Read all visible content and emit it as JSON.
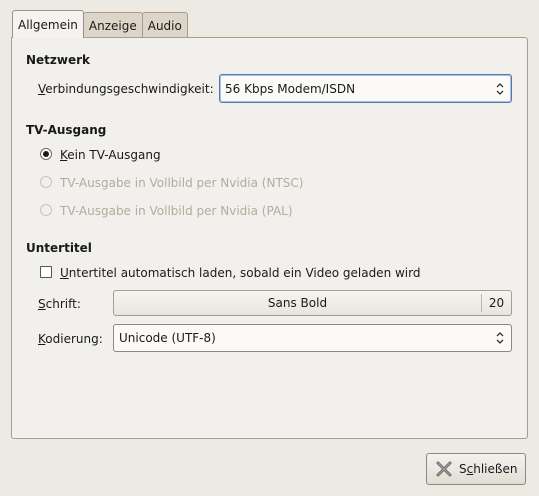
{
  "tabs": [
    {
      "label": "Allgemein",
      "active": true
    },
    {
      "label": "Anzeige",
      "active": false
    },
    {
      "label": "Audio",
      "active": false
    }
  ],
  "network": {
    "title": "Netzwerk",
    "speed_label_mnemonic": "V",
    "speed_label_rest": "erbindungsgeschwindigkeit:",
    "speed_value": "56 Kbps Modem/ISDN"
  },
  "tv": {
    "title": "TV-Ausgang",
    "options": [
      {
        "mnemonic": "K",
        "rest": "ein TV-Ausgang",
        "checked": true,
        "disabled": false
      },
      {
        "mnemonic": "",
        "rest": "TV-Ausgabe in Vollbild per Nvidia (NTSC)",
        "checked": false,
        "disabled": true
      },
      {
        "mnemonic": "",
        "rest": "TV-Ausgabe in Vollbild per Nvidia (PAL)",
        "checked": false,
        "disabled": true
      }
    ]
  },
  "subtitles": {
    "title": "Untertitel",
    "autoload_mnemonic": "U",
    "autoload_rest": "ntertitel automatisch laden, sobald ein Video geladen wird",
    "autoload_checked": false,
    "font_label_mnemonic": "S",
    "font_label_rest": "chrift:",
    "font_name": "Sans Bold",
    "font_size": "20",
    "encoding_label_mnemonic": "K",
    "encoding_label_rest": "odierung:",
    "encoding_value": "Unicode (UTF-8)"
  },
  "footer": {
    "close_prefix": "S",
    "close_mnemonic": "c",
    "close_rest": "hließen"
  }
}
